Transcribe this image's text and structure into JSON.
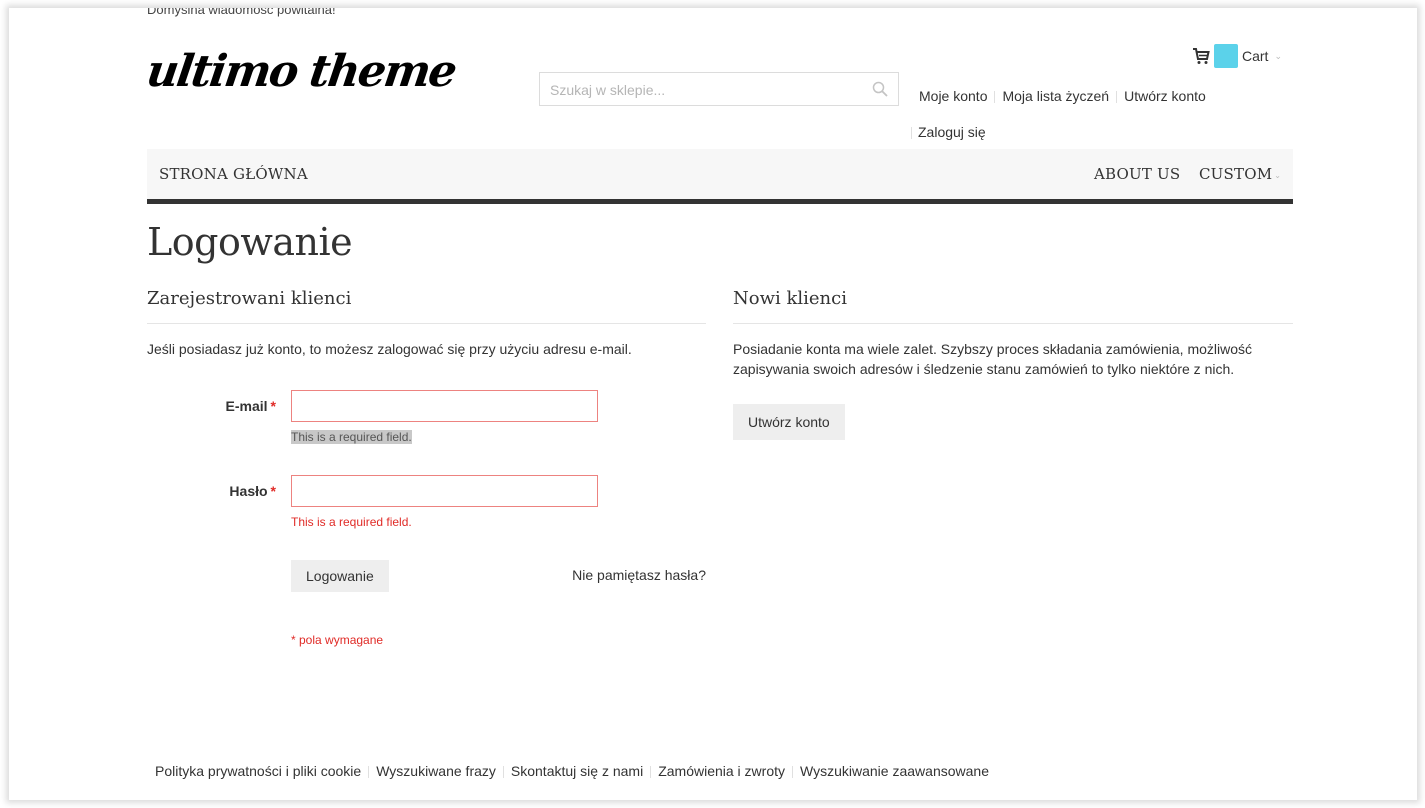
{
  "header": {
    "welcome": "Domyślna wiadomość powitalna!",
    "logo_text": "ultimo theme",
    "search": {
      "placeholder": "Szukaj w sklepie...",
      "value": "",
      "icon": "search-icon"
    },
    "cart": {
      "label": "Cart",
      "icon": "cart-icon",
      "badge_color": "#5bd2ea"
    },
    "top_links": [
      {
        "label": "Moje konto"
      },
      {
        "label": "Moja lista życzeń"
      },
      {
        "label": "Utwórz konto"
      },
      {
        "label": "Zaloguj się"
      }
    ]
  },
  "nav": {
    "left": [
      {
        "label": "STRONA GŁÓWNA"
      }
    ],
    "right": [
      {
        "label": "ABOUT US"
      },
      {
        "label": "CUSTOM",
        "has_dropdown": true
      }
    ]
  },
  "page": {
    "title": "Logowanie",
    "registered": {
      "heading": "Zarejestrowani klienci",
      "intro": "Jeśli posiadasz już konto, to możesz zalogować się przy użyciu adresu e-mail.",
      "fields": [
        {
          "label": "E-mail",
          "required_mark": "*",
          "value": "",
          "error": "This is a required field.",
          "error_highlighted": true
        },
        {
          "label": "Hasło",
          "required_mark": "*",
          "value": "",
          "error": "This is a required field.",
          "error_highlighted": false
        }
      ],
      "login_button": "Logowanie",
      "forgot_link": "Nie pamiętasz hasła?",
      "required_note": "* pola wymagane"
    },
    "new_customers": {
      "heading": "Nowi klienci",
      "text": "Posiadanie konta ma wiele zalet. Szybszy proces składania zamówienia, możliwość zapisywania swoich adresów i śledzenie stanu zamówień to tylko niektóre z nich.",
      "create_button": "Utwórz konto"
    }
  },
  "footer": {
    "links": [
      {
        "label": "Polityka prywatności i pliki cookie"
      },
      {
        "label": "Wyszukiwane frazy"
      },
      {
        "label": "Skontaktuj się z nami"
      },
      {
        "label": "Zamówienia i zwroty"
      },
      {
        "label": "Wyszukiwanie zaawansowane"
      }
    ]
  },
  "colors": {
    "error": "#e02b27",
    "nav_border": "#333333",
    "button_bg": "#eeeeee",
    "field_error_border": "#ed8380"
  }
}
